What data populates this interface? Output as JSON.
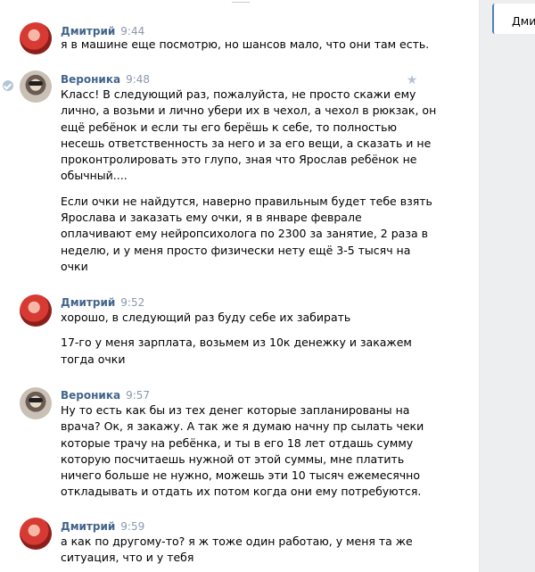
{
  "chat": {
    "messages": [
      {
        "author": "Дмитрий",
        "time": "9:44",
        "avatar": "red-hair-avatar",
        "lines": [
          "я в машине еще посмотрю, но шансов мало, что они там есть."
        ]
      },
      {
        "author": "Вероника",
        "time": "9:48",
        "avatar": "sunglasses-avatar",
        "lines": [
          "Класс! В следующий раз, пожалуйста, не просто скажи ему",
          "лично, а возьми и лично убери их в чехол, а чехол в рюкзак, он",
          "ещё ребёнок и если ты его берёшь к себе, то полностью",
          "несешь ответственность за него и за его вещи, а сказать и не",
          "проконтролировать это глупо, зная что Ярослав ребёнок не",
          "обычный....",
          "",
          "Если очки не найдутся, наверно правильным будет тебе взять",
          "Ярослава и заказать ему очки, я в январе феврале",
          "оплачивают ему нейропсихолога по 2300 за занятие, 2 раза в",
          "неделю, и у меня просто физически нету ещё 3-5 тысяч на",
          "очки"
        ]
      },
      {
        "author": "Дмитрий",
        "time": "9:52",
        "avatar": "red-hair-avatar",
        "lines": [
          "хорошо, в следующий раз буду себе их забирать",
          "",
          "17-го у меня зарплата, возьмем из 10к денежку и закажем",
          "тогда очки"
        ]
      },
      {
        "author": "Вероника",
        "time": "9:57",
        "avatar": "sunglasses-avatar",
        "lines": [
          "Ну то есть как бы из тех денег которые запланированы на",
          "врача? Ок, я закажу. А так же я думаю начну пр сылать чеки",
          "которые трачу на ребёнка, и ты в его 18 лет отдашь сумму",
          "которую посчитаешь нужной от этой суммы, мне платить",
          "ничего больше не нужно, можешь эти 10 тысяч ежемесячно",
          "откладывать и отдать их потом когда они ему потребуются."
        ]
      },
      {
        "author": "Дмитрий",
        "time": "9:59",
        "avatar": "red-hair-avatar",
        "lines": [
          "а как по другому-то? я ж тоже один работаю, у меня та же",
          "ситуация, что и у тебя"
        ]
      }
    ]
  },
  "sidebar": {
    "active_tab": "Дмит"
  },
  "colors": {
    "author": "#42648b",
    "time": "#8a99ad",
    "sidebar_bg": "#edeef0",
    "accent": "#5181b8"
  }
}
